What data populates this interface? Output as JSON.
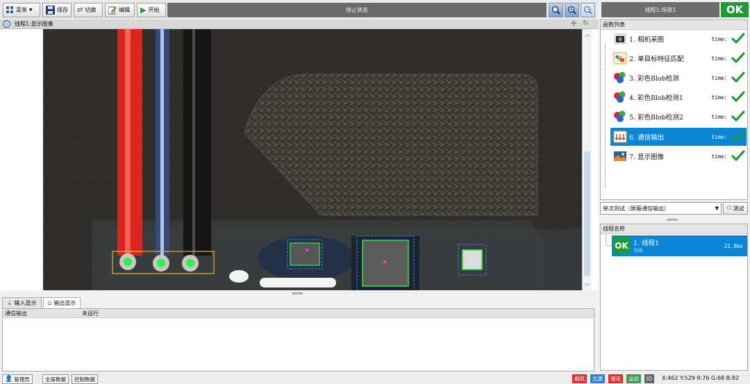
{
  "toolbar": {
    "menu_label": "菜单",
    "save_label": "保存",
    "switch_label": "切换",
    "edit_label": "编辑",
    "start_label": "开始",
    "status_text": "停止状态"
  },
  "image_panel": {
    "title": "线程1:显示图像"
  },
  "output_tabs": [
    {
      "label": "输入显示"
    },
    {
      "label": "输出显示"
    }
  ],
  "output_table": {
    "columns": [
      "通信输出",
      "未运行"
    ]
  },
  "statusbar": {
    "user_label": "管理员",
    "global_data_label": "全局数据",
    "control_data_label": "控制数据",
    "indicators": [
      "相机",
      "光源",
      "通讯",
      "运动",
      "IO"
    ],
    "indicator_colors": [
      "#e52d2d",
      "#2f7fd6",
      "#e52d2d",
      "#3d9a48",
      "#666666"
    ],
    "readout": "X:462 Y:529  R:76 G:68 B:82"
  },
  "right": {
    "title": "线程1:场景1",
    "result": "OK",
    "func_list_header": "函数列表",
    "functions": [
      {
        "name": "1. 相机采图",
        "time_label": "time:",
        "icon": "camera-icon"
      },
      {
        "name": "2. 单目标特征匹配",
        "time_label": "time:",
        "icon": "feature-match-icon"
      },
      {
        "name": "3. 彩色Blob检测",
        "time_label": "time:",
        "icon": "color-blob-icon"
      },
      {
        "name": "4. 彩色Blob检测1",
        "time_label": "time:",
        "icon": "color-blob-icon"
      },
      {
        "name": "5. 彩色Blob检测2",
        "time_label": "time:",
        "icon": "color-blob-icon"
      },
      {
        "name": "6. 通信输出",
        "time_label": "time:",
        "icon": "comm-output-icon",
        "selected": true
      },
      {
        "name": "7. 显示图像",
        "time_label": "time:",
        "icon": "display-image-icon"
      }
    ],
    "test_select_value": "单次测试（屏蔽通信输出）",
    "test_button_label": "测试",
    "flow_header": "线程名称",
    "flow_item": {
      "badge": "OK",
      "name": "1. 线程1",
      "sub": "场景",
      "time": "21.8ms"
    }
  },
  "colors": {
    "accent": "#0b86d6",
    "ok_green": "#1e9b34"
  }
}
